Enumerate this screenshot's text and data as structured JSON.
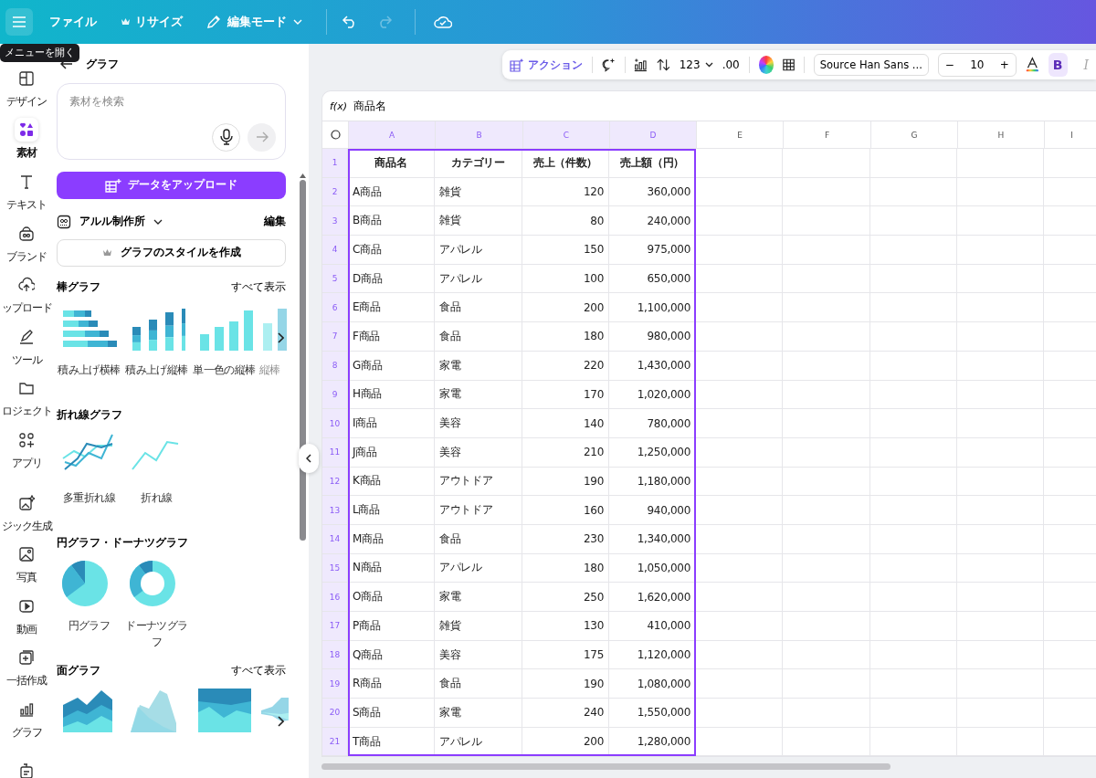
{
  "top_bar": {
    "menu_tooltip": "メニューを開く",
    "items": [
      {
        "kind": "file",
        "label": "ファイル"
      },
      {
        "kind": "resize",
        "label": "リサイズ"
      },
      {
        "kind": "mode",
        "label": "編集モード"
      }
    ],
    "history": [
      {
        "kind": "undo",
        "disabled": false
      },
      {
        "kind": "redo",
        "disabled": true
      }
    ]
  },
  "rail": {
    "groups": [
      [
        {
          "kind": "design",
          "label": "デザイン",
          "selected": false
        },
        {
          "kind": "elements",
          "label": "素材",
          "selected": true
        },
        {
          "kind": "text",
          "label": "テキスト",
          "selected": false
        },
        {
          "kind": "brand",
          "label": "ブランド",
          "selected": false
        },
        {
          "kind": "upload",
          "label": "ップロード",
          "selected": false
        },
        {
          "kind": "tools",
          "label": "ツール",
          "selected": false
        },
        {
          "kind": "projects",
          "label": "ロジェクト",
          "selected": false
        },
        {
          "kind": "apps",
          "label": "アプリ",
          "selected": false
        }
      ],
      [
        {
          "kind": "magic",
          "label": "ジック生成",
          "selected": false
        },
        {
          "kind": "photo",
          "label": "写真",
          "selected": false
        },
        {
          "kind": "video",
          "label": "動画",
          "selected": false
        },
        {
          "kind": "bulk",
          "label": "一括作成",
          "selected": false
        },
        {
          "kind": "chart",
          "label": "グラフ",
          "selected": false
        },
        {
          "kind": "more",
          "selected": false
        }
      ]
    ]
  },
  "panel": {
    "title": "グラフ",
    "search": {
      "placeholder": "素材を検索"
    },
    "upload_button": "データをアップロード",
    "brand": {
      "name": "アルル制作所",
      "action": "編集"
    },
    "style_button": "グラフのスタイルを作成",
    "sections": [
      {
        "title": "棒グラフ",
        "see_all": "すべて表示",
        "more": true,
        "items": [
          {
            "kind": "stacked-hbar",
            "label": "積み上げ横棒"
          },
          {
            "kind": "stacked-vbar",
            "label": "積み上げ縦棒"
          },
          {
            "kind": "vbar",
            "label": "単一色の縦棒"
          },
          {
            "kind": "vbar-partial",
            "label": "縦棒"
          }
        ]
      },
      {
        "title": "折れ線グラフ",
        "more": false,
        "items": [
          {
            "kind": "multi-line",
            "label": "多重折れ線"
          },
          {
            "kind": "line",
            "label": "折れ線"
          }
        ]
      },
      {
        "title": "円グラフ・ドーナツグラフ",
        "more": false,
        "items": [
          {
            "kind": "pie",
            "label": "円グラフ"
          },
          {
            "kind": "donut",
            "label": "ドーナツグラフ"
          }
        ]
      },
      {
        "title": "面グラフ",
        "see_all": "すべて表示",
        "more": true,
        "items": [
          {
            "kind": "area-stacked"
          },
          {
            "kind": "area-overlap"
          },
          {
            "kind": "area-full"
          },
          {
            "kind": "area-stream"
          }
        ]
      }
    ]
  },
  "toolbar": {
    "action": "アクション",
    "number_format": "123",
    "decimals": ".00",
    "font": "Source Han Sans ...",
    "size_minus": "−",
    "font_size": "10",
    "size_plus": "+",
    "styles": [
      {
        "kind": "bold",
        "label": "B",
        "on": true
      },
      {
        "kind": "italic",
        "label": "I",
        "on": false
      }
    ]
  },
  "formula_bar": {
    "label": "f(x)",
    "value": "商品名"
  },
  "sheet": {
    "columns": [
      {
        "label": "A",
        "selected": true
      },
      {
        "label": "B",
        "selected": true
      },
      {
        "label": "C",
        "selected": true
      },
      {
        "label": "D",
        "selected": true
      },
      {
        "label": "E",
        "selected": false
      },
      {
        "label": "F",
        "selected": false
      },
      {
        "label": "G",
        "selected": false
      },
      {
        "label": "H",
        "selected": false
      },
      {
        "label": "I",
        "selected": false
      }
    ],
    "rows": [
      {
        "number": "1",
        "header": true,
        "cells": [
          "商品名",
          "カテゴリー",
          "売上（件数）",
          "売上額（円）"
        ]
      },
      {
        "number": "2",
        "header": false,
        "cells": [
          "A商品",
          "雑貨",
          "120",
          "360,000"
        ]
      },
      {
        "number": "3",
        "header": false,
        "cells": [
          "B商品",
          "雑貨",
          "80",
          "240,000"
        ]
      },
      {
        "number": "4",
        "header": false,
        "cells": [
          "C商品",
          "アパレル",
          "150",
          "975,000"
        ]
      },
      {
        "number": "5",
        "header": false,
        "cells": [
          "D商品",
          "アパレル",
          "100",
          "650,000"
        ]
      },
      {
        "number": "6",
        "header": false,
        "cells": [
          "E商品",
          "食品",
          "200",
          "1,100,000"
        ]
      },
      {
        "number": "7",
        "header": false,
        "cells": [
          "F商品",
          "食品",
          "180",
          "980,000"
        ]
      },
      {
        "number": "8",
        "header": false,
        "cells": [
          "G商品",
          "家電",
          "220",
          "1,430,000"
        ]
      },
      {
        "number": "9",
        "header": false,
        "cells": [
          "H商品",
          "家電",
          "170",
          "1,020,000"
        ]
      },
      {
        "number": "10",
        "header": false,
        "cells": [
          "I商品",
          "美容",
          "140",
          "780,000"
        ]
      },
      {
        "number": "11",
        "header": false,
        "cells": [
          "J商品",
          "美容",
          "210",
          "1,250,000"
        ]
      },
      {
        "number": "12",
        "header": false,
        "cells": [
          "K商品",
          "アウトドア",
          "190",
          "1,180,000"
        ]
      },
      {
        "number": "13",
        "header": false,
        "cells": [
          "L商品",
          "アウトドア",
          "160",
          "940,000"
        ]
      },
      {
        "number": "14",
        "header": false,
        "cells": [
          "M商品",
          "食品",
          "230",
          "1,340,000"
        ]
      },
      {
        "number": "15",
        "header": false,
        "cells": [
          "N商品",
          "アパレル",
          "180",
          "1,050,000"
        ]
      },
      {
        "number": "16",
        "header": false,
        "cells": [
          "O商品",
          "家電",
          "250",
          "1,620,000"
        ]
      },
      {
        "number": "17",
        "header": false,
        "cells": [
          "P商品",
          "雑貨",
          "130",
          "410,000"
        ]
      },
      {
        "number": "18",
        "header": false,
        "cells": [
          "Q商品",
          "美容",
          "175",
          "1,120,000"
        ]
      },
      {
        "number": "19",
        "header": false,
        "cells": [
          "R商品",
          "食品",
          "190",
          "1,080,000"
        ]
      },
      {
        "number": "20",
        "header": false,
        "cells": [
          "S商品",
          "家電",
          "240",
          "1,550,000"
        ]
      },
      {
        "number": "21",
        "header": false,
        "cells": [
          "T商品",
          "アパレル",
          "200",
          "1,280,000"
        ]
      }
    ]
  }
}
